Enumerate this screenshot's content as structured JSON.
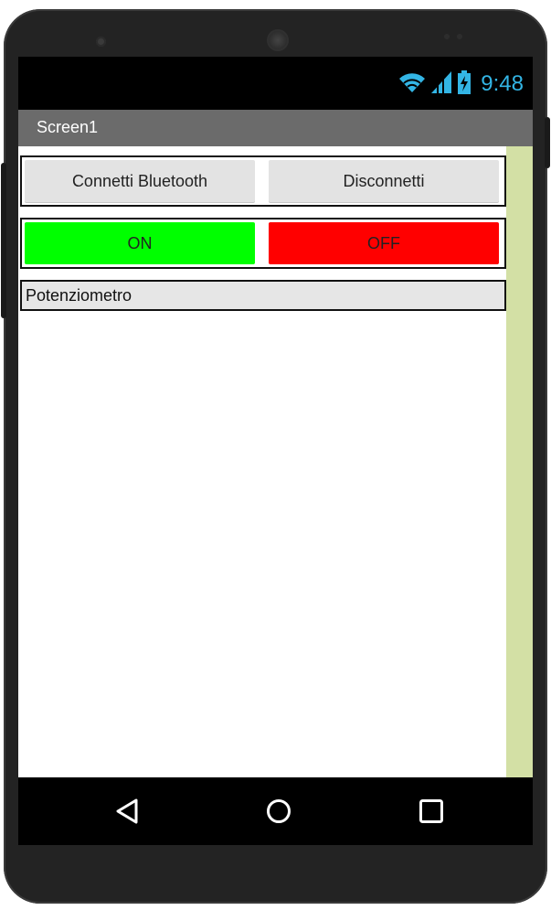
{
  "status_bar": {
    "time": "9:48",
    "icons": [
      "wifi-icon",
      "signal-icon",
      "battery-charging-icon"
    ],
    "accent_color": "#33b5e5"
  },
  "title_bar": {
    "title": "Screen1",
    "background": "#6b6b6b"
  },
  "bluetooth_row": {
    "connect_label": "Connetti Bluetooth",
    "disconnect_label": "Disconnetti"
  },
  "switch_row": {
    "on_label": "ON",
    "off_label": "OFF",
    "on_color": "#00ff00",
    "off_color": "#ff0000"
  },
  "potentiometer": {
    "label": "Potenziometro"
  },
  "nav_bar": {
    "icons": [
      "back-icon",
      "home-icon",
      "recents-icon"
    ]
  }
}
